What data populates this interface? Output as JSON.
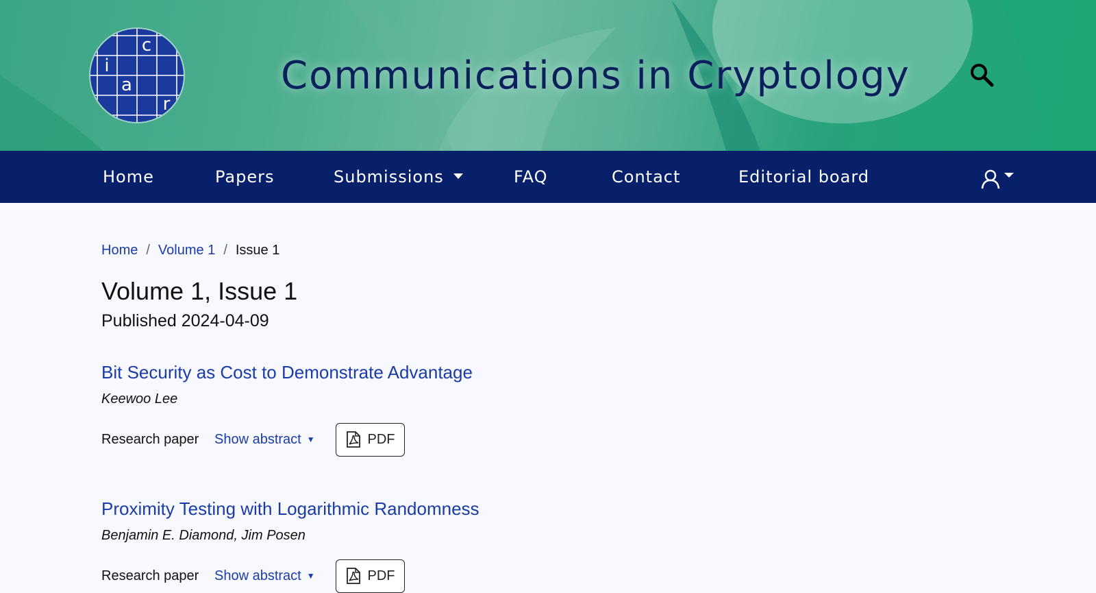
{
  "site": {
    "title": "Communications in Cryptology",
    "logo_letters": [
      "c",
      "i",
      "a",
      "r"
    ]
  },
  "nav": {
    "items": [
      {
        "label": "Home"
      },
      {
        "label": "Papers"
      },
      {
        "label": "Submissions",
        "dropdown": true
      },
      {
        "label": "FAQ"
      },
      {
        "label": "Contact"
      },
      {
        "label": "Editorial board"
      }
    ],
    "icons": {
      "search": "search-icon",
      "user": "user-icon"
    }
  },
  "breadcrumb": {
    "home": "Home",
    "volume": "Volume 1",
    "separator": "/",
    "current": "Issue 1"
  },
  "issue": {
    "title": "Volume 1, Issue 1",
    "published": "Published 2024-04-09"
  },
  "papers": [
    {
      "title": "Bit Security as Cost to Demonstrate Advantage",
      "authors": "Keewoo Lee",
      "type": "Research paper",
      "abstract_label": "Show abstract",
      "pdf_label": "PDF"
    },
    {
      "title": "Proximity Testing with Logarithmic Randomness",
      "authors": "Benjamin E. Diamond, Jim Posen",
      "type": "Research paper",
      "abstract_label": "Show abstract",
      "pdf_label": "PDF"
    }
  ],
  "colors": {
    "navbar": "#08206a",
    "link": "#1a3ca8",
    "title": "#0b1f5c",
    "banner": "#4cae8e"
  }
}
